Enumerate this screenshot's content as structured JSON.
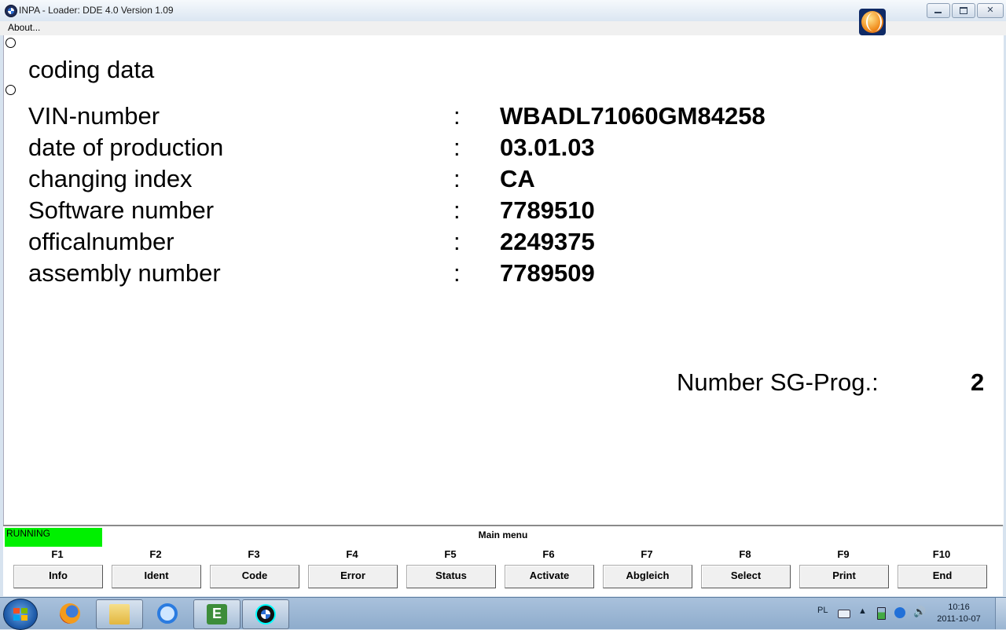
{
  "window": {
    "title": "INPA - Loader:  DDE 4.0 Version 1.09",
    "menu_about": "About..."
  },
  "content": {
    "heading": "coding data",
    "rows": [
      {
        "label": "VIN-number",
        "sep": ":",
        "value": "WBADL71060GM84258"
      },
      {
        "label": "date of production",
        "sep": ":",
        "value": "03.01.03"
      },
      {
        "label": "changing index",
        "sep": ":",
        "value": "CA"
      },
      {
        "label": "Software number",
        "sep": ":",
        "value": "7789510"
      },
      {
        "label": "officalnumber",
        "sep": ":",
        "value": "2249375"
      },
      {
        "label": "assembly number",
        "sep": ":",
        "value": "7789509"
      }
    ],
    "sg_prog_label": "Number SG-Prog.:",
    "sg_prog_value": "2"
  },
  "status": {
    "running": "RUNNING",
    "running_color": "#00f000",
    "menu_title": "Main menu"
  },
  "fkeys": [
    {
      "key": "F1",
      "label": "Info"
    },
    {
      "key": "F2",
      "label": "Ident"
    },
    {
      "key": "F3",
      "label": "Code"
    },
    {
      "key": "F4",
      "label": "Error"
    },
    {
      "key": "F5",
      "label": "Status"
    },
    {
      "key": "F6",
      "label": "Activate"
    },
    {
      "key": "F7",
      "label": "Abgleich"
    },
    {
      "key": "F8",
      "label": "Select"
    },
    {
      "key": "F9",
      "label": "Print"
    },
    {
      "key": "F10",
      "label": "End"
    }
  ],
  "taskbar": {
    "apps": [
      "firefox-icon",
      "folder-icon",
      "internet-explorer-icon",
      "ebook-icon",
      "bmw-inpa-icon"
    ],
    "language": "PL",
    "time": "10:16",
    "date": "2011-10-07"
  }
}
